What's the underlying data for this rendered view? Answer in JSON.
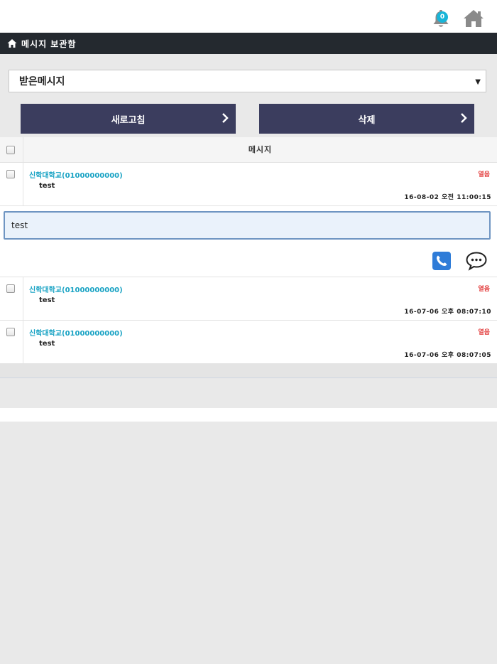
{
  "header": {
    "notification_count": "0",
    "title": "메시지 보관함"
  },
  "filter": {
    "selected": "받은메시지"
  },
  "actions": {
    "refresh_label": "새로고침",
    "delete_label": "삭제"
  },
  "table": {
    "column_header": "메시지",
    "detail": {
      "text": "test"
    },
    "rows": [
      {
        "sender": "신학대학교(01000000000)",
        "status": "열음",
        "text": "test",
        "date": "16-08-02 오전 11:00:15"
      },
      {
        "sender": "신학대학교(01000000000)",
        "status": "열음",
        "text": "test",
        "date": "16-07-06 오후 08:07:10"
      },
      {
        "sender": "신학대학교(01000000000)",
        "status": "열음",
        "text": "test",
        "date": "16-07-06 오후 08:07:05"
      }
    ]
  },
  "colors": {
    "title_bar": "#24292f",
    "button": "#3b3d5e",
    "sender": "#1aa3c4",
    "status": "#e23b3b",
    "badge": "#19b5d8"
  },
  "icons": [
    "bell-icon",
    "home-icon",
    "chevron-right-icon",
    "phone-icon",
    "chat-bubble-icon",
    "checkbox"
  ]
}
